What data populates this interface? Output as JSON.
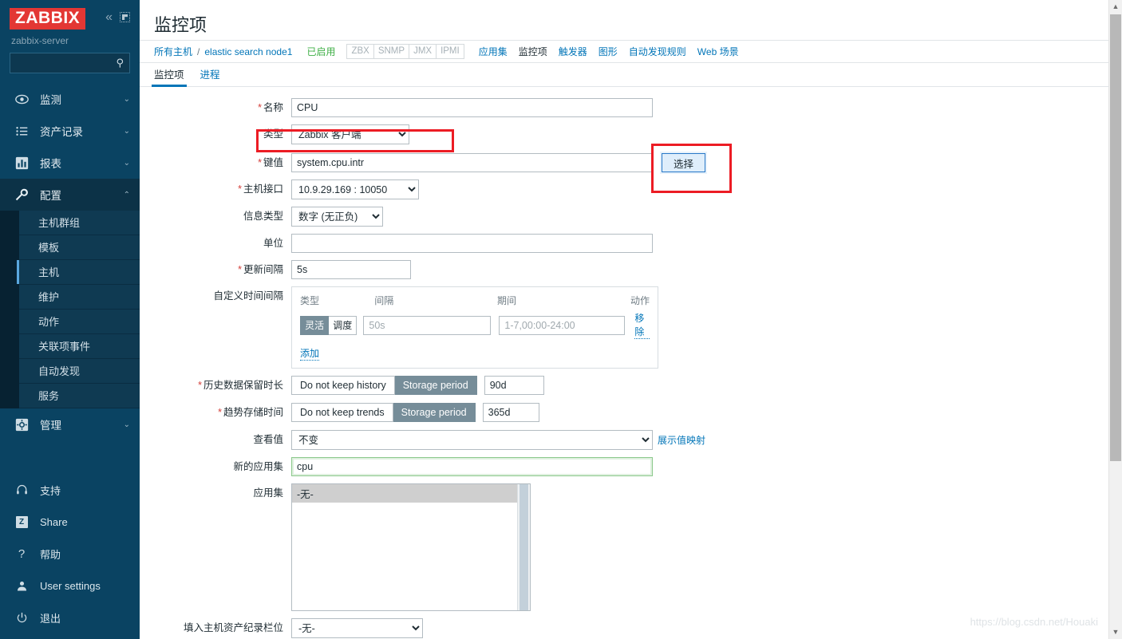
{
  "sidebar": {
    "logo": "ZABBIX",
    "server": "zabbix-server",
    "search_placeholder": "",
    "collapse_icon": "«",
    "nav": [
      {
        "label": "监测",
        "icon": "eye-icon",
        "chevron": "⌄"
      },
      {
        "label": "资产记录",
        "icon": "list-icon",
        "chevron": "⌄"
      },
      {
        "label": "报表",
        "icon": "chart-icon",
        "chevron": "⌄"
      },
      {
        "label": "配置",
        "icon": "wrench-icon",
        "chevron": "⌃"
      }
    ],
    "sub_items": [
      "主机群组",
      "模板",
      "主机",
      "维护",
      "动作",
      "关联项事件",
      "自动发现",
      "服务"
    ],
    "active_sub": "主机",
    "admin": {
      "label": "管理",
      "icon": "gear-icon",
      "chevron": "⌄"
    },
    "footer": [
      {
        "label": "支持",
        "icon": "headset-icon"
      },
      {
        "label": "Share",
        "icon": "zabbix-share-icon"
      },
      {
        "label": "帮助",
        "icon": "question-icon"
      },
      {
        "label": "User settings",
        "icon": "user-icon"
      },
      {
        "label": "退出",
        "icon": "power-icon"
      }
    ]
  },
  "header": {
    "title": "监控项",
    "breadcrumb": {
      "all_hosts": "所有主机",
      "separator": "/",
      "host": "elastic search node1",
      "status": "已启用",
      "badges": [
        "ZBX",
        "SNMP",
        "JMX",
        "IPMI"
      ],
      "nav": [
        {
          "label": "应用集",
          "current": false
        },
        {
          "label": "监控项",
          "current": true
        },
        {
          "label": "触发器",
          "current": false
        },
        {
          "label": "图形",
          "current": false
        },
        {
          "label": "自动发现规则",
          "current": false
        },
        {
          "label": "Web 场景",
          "current": false
        }
      ]
    },
    "tabs": [
      {
        "label": "监控项",
        "active": true
      },
      {
        "label": "进程",
        "active": false
      }
    ]
  },
  "form": {
    "name": {
      "label": "名称",
      "required": true,
      "value": "CPU"
    },
    "type": {
      "label": "类型",
      "required": false,
      "value": "Zabbix 客户端"
    },
    "key": {
      "label": "键值",
      "required": true,
      "value": "system.cpu.intr",
      "button": "选择"
    },
    "host_iface": {
      "label": "主机接口",
      "required": true,
      "value": "10.9.29.169 : 10050"
    },
    "info_type": {
      "label": "信息类型",
      "required": false,
      "value": "数字 (无正负)"
    },
    "units": {
      "label": "单位",
      "required": false,
      "value": ""
    },
    "interval": {
      "label": "更新间隔",
      "required": true,
      "value": "5s"
    },
    "custom_intervals": {
      "label": "自定义时间间隔",
      "headers": [
        "类型",
        "间隔",
        "期间",
        "动作"
      ],
      "rows": [
        {
          "type_options": [
            "灵活",
            "调度"
          ],
          "type_selected": "灵活",
          "interval_placeholder": "50s",
          "interval_value": "",
          "period_placeholder": "1-7,00:00-24:00",
          "period_value": "",
          "action": "移除"
        }
      ],
      "add_label": "添加"
    },
    "history": {
      "label": "历史数据保留时长",
      "required": true,
      "options": [
        "Do not keep history",
        "Storage period"
      ],
      "selected": "Storage period",
      "value": "90d"
    },
    "trends": {
      "label": "趋势存储时间",
      "required": true,
      "options": [
        "Do not keep trends",
        "Storage period"
      ],
      "selected": "Storage period",
      "value": "365d"
    },
    "view_value": {
      "label": "查看值",
      "required": false,
      "value": "不变",
      "link": "展示值映射"
    },
    "new_app": {
      "label": "新的应用集",
      "required": false,
      "value": "cpu"
    },
    "app_set": {
      "label": "应用集",
      "required": false,
      "options": [
        "-无-"
      ],
      "selected": "-无-"
    },
    "inventory_field": {
      "label": "填入主机资产纪录栏位",
      "required": false,
      "value": "-无-"
    }
  },
  "watermark": "https://blog.csdn.net/Houaki",
  "colors": {
    "sidebar_bg": "#0a4362",
    "logo_red": "#e33734",
    "link_blue": "#0275b8",
    "status_green": "#3faf46",
    "annotation_red": "#ec1c24",
    "segment_active": "#768d99"
  }
}
